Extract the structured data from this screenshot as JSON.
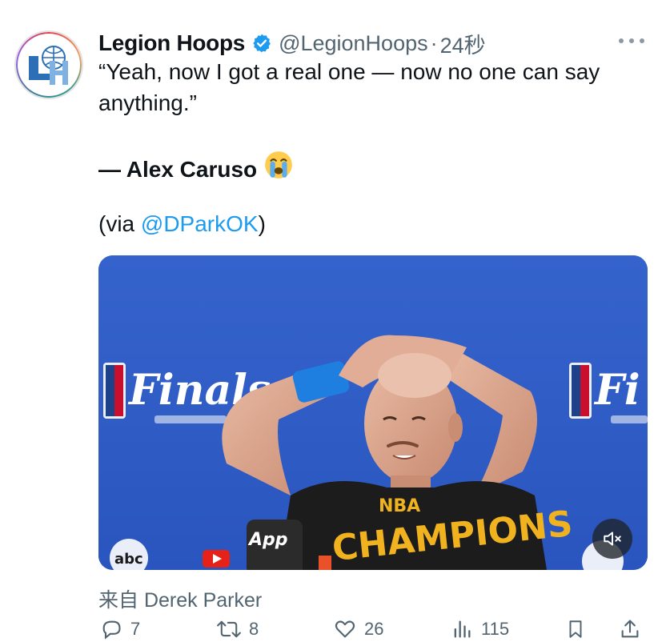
{
  "tweet": {
    "author_name": "Legion Hoops",
    "handle": "@LegionHoops",
    "separator": "·",
    "time": "24秒",
    "avatar_text": "LH",
    "text": "“Yeah, now I got a real one — now no one can say anything.”",
    "quote_attribution": "— Alex Caruso",
    "via_prefix": "(via ",
    "via_mention": "@DPark",
    "via_mention_highlight": "OK",
    "via_suffix": ")",
    "emoji": "loudly-crying-face",
    "source": "来自 Derek Parker"
  },
  "media": {
    "backdrop_brand": "Finals",
    "backdrop_brand_right": "Fi",
    "shirt_text_line1": "NBA",
    "shirt_text_line2": "CHAMPIONS",
    "mic_brand": "App",
    "bottom_logo": "abc",
    "mute_icon": "speaker-muted-icon"
  },
  "actions": {
    "reply_count": "7",
    "retweet_count": "8",
    "like_count": "26",
    "view_count": "115"
  },
  "colors": {
    "accent": "#1d9bf0",
    "secondary_text": "#536471",
    "backdrop_blue": "#2f5ec8"
  }
}
